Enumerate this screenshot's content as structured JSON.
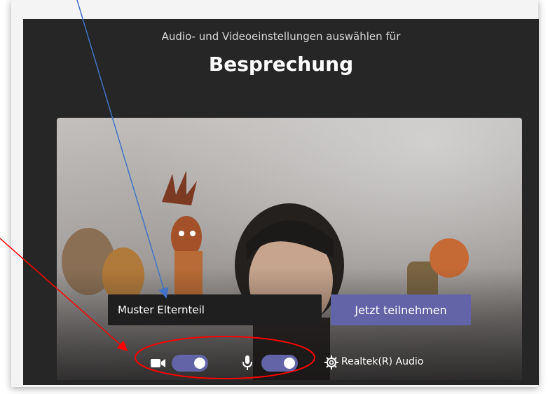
{
  "header": {
    "subtitle": "Audio- und Videoeinstellungen auswählen für",
    "title": "Besprechung"
  },
  "prejoin": {
    "name_value": "Muster Elternteil",
    "join_label": "Jetzt teilnehmen"
  },
  "controls": {
    "camera_on": true,
    "mic_on": true,
    "audio_device_label": "Realtek(R) Audio"
  },
  "colors": {
    "accent": "#6264a7",
    "background": "#262626",
    "annotation_blue": "#4472c4",
    "annotation_red": "#ff0000"
  }
}
